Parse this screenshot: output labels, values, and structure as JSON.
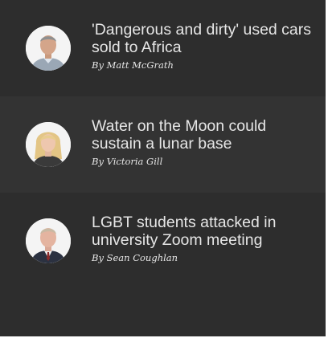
{
  "stories": [
    {
      "headline": "'Dangerous and dirty' used cars sold to Africa",
      "byline": "By Matt McGrath",
      "avatar_icon": "author-photo-matt-mcgrath"
    },
    {
      "headline": "Water on the Moon could sustain a lunar base",
      "byline": "By Victoria Gill",
      "avatar_icon": "author-photo-victoria-gill"
    },
    {
      "headline": "LGBT students attacked in university Zoom meeting",
      "byline": "By Sean Coughlan",
      "avatar_icon": "author-photo-sean-coughlan"
    }
  ],
  "colors": {
    "panel_bg": "#2d2d2d",
    "panel_bg_alt": "#333333",
    "text": "#e6e6e6"
  }
}
